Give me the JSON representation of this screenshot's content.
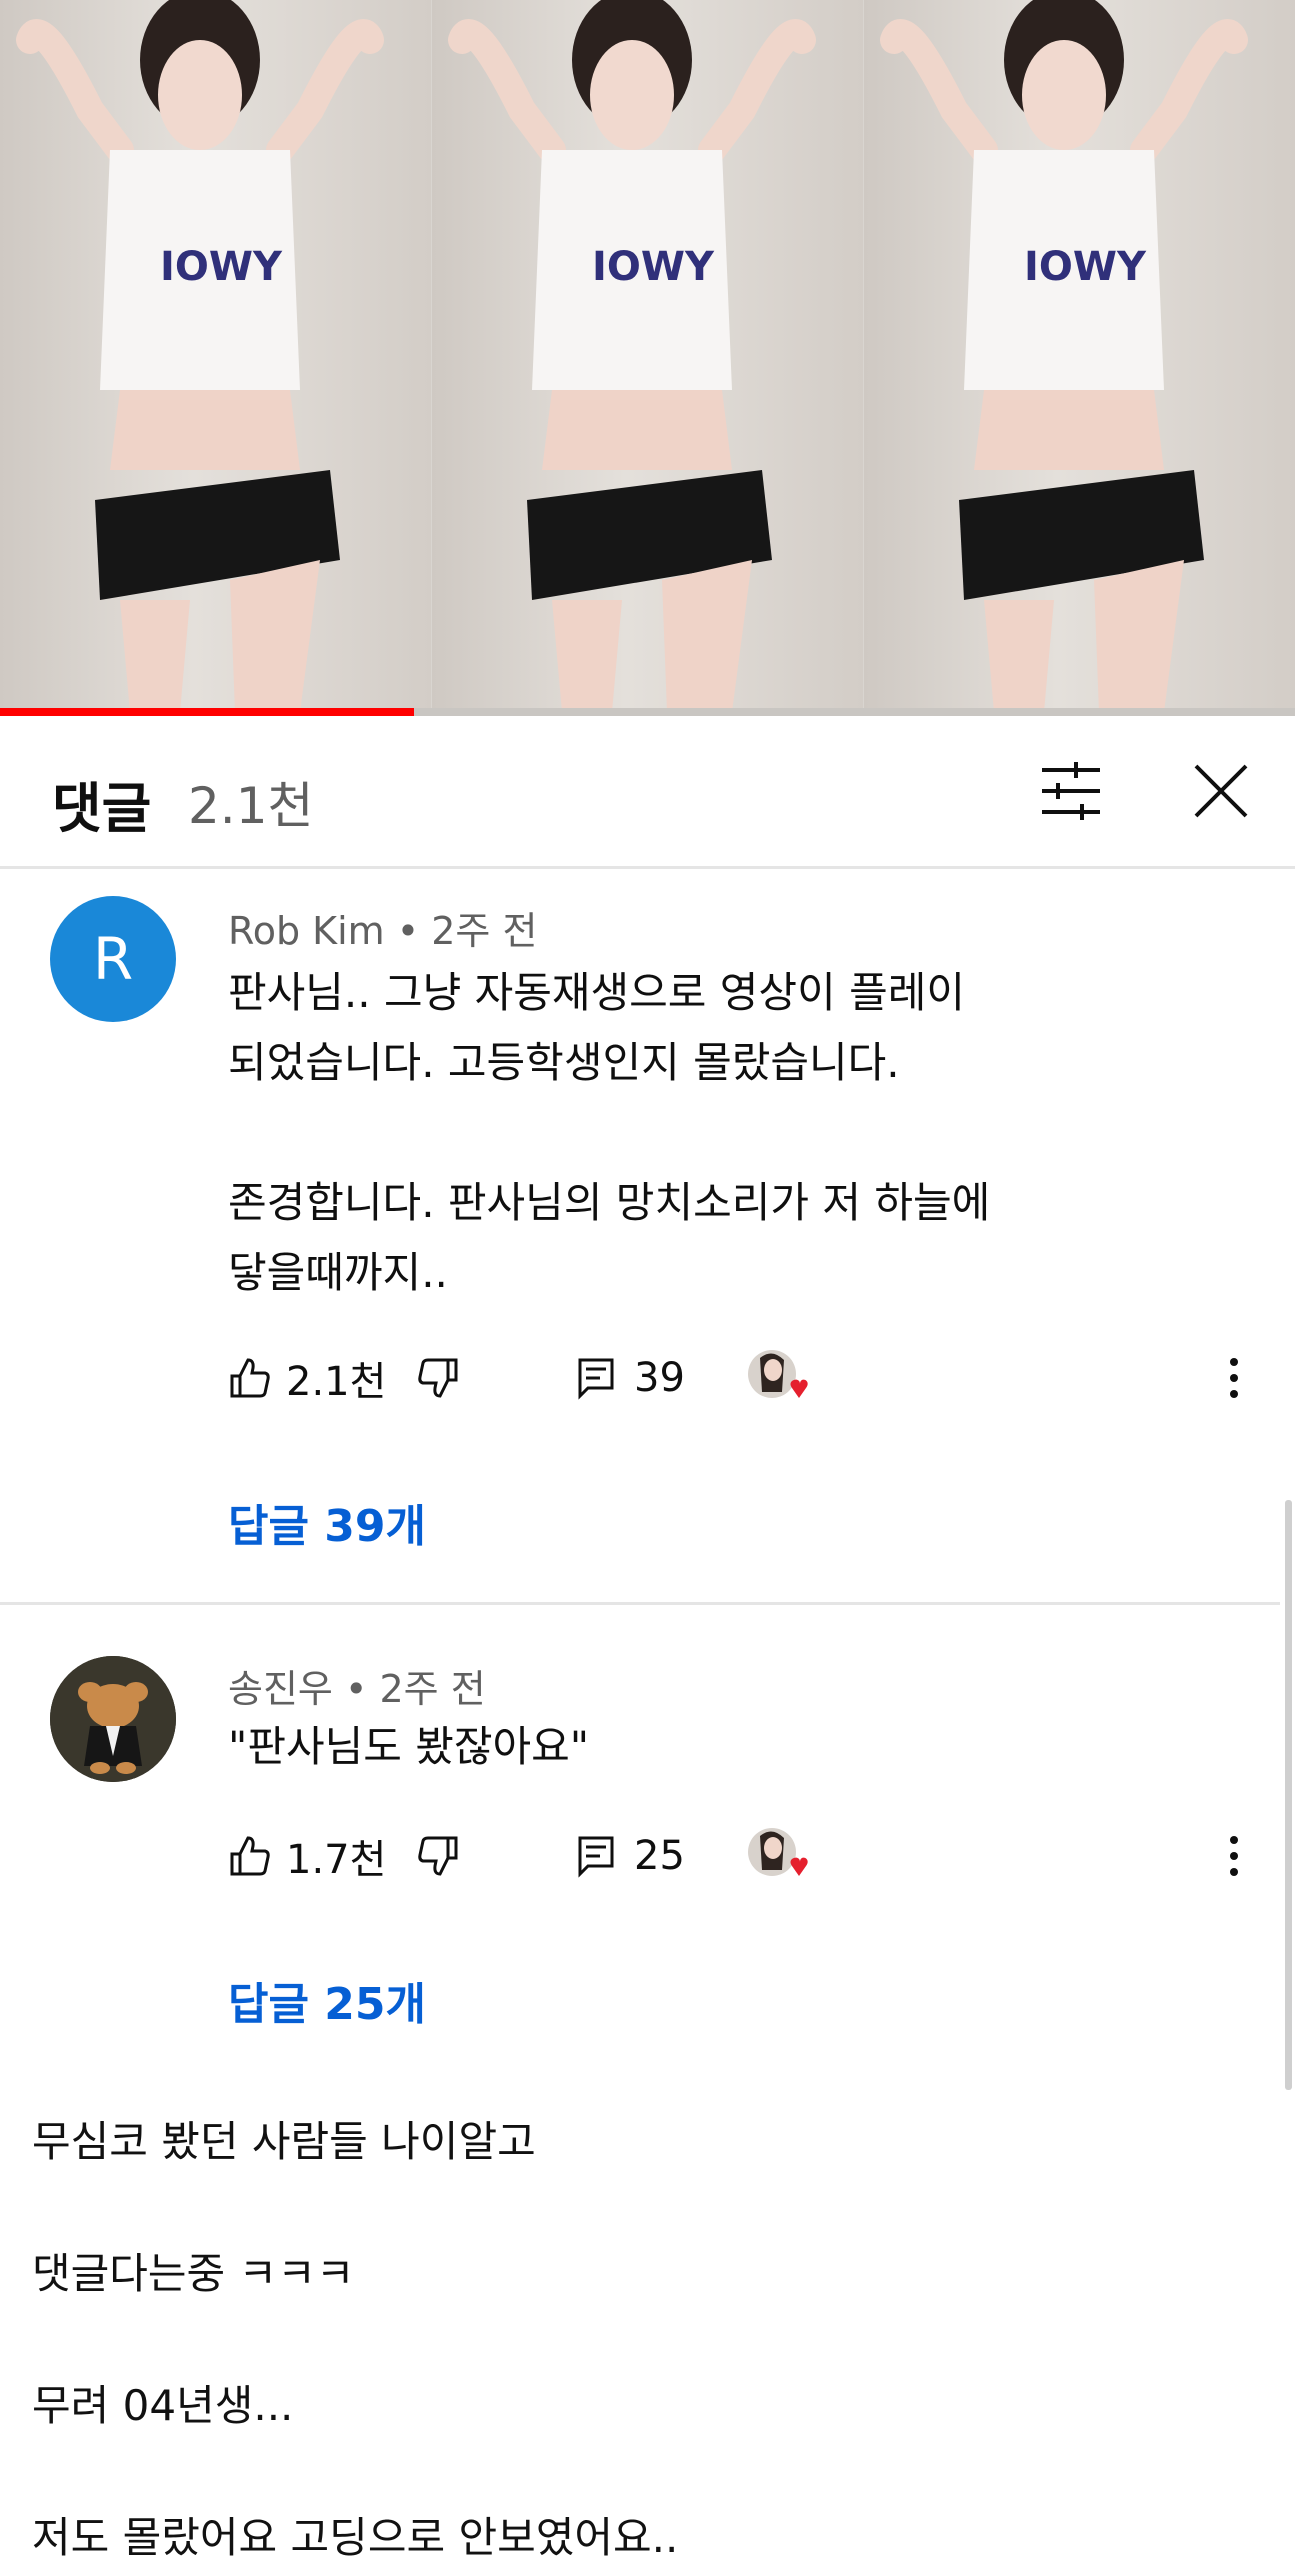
{
  "video": {
    "progress_fraction": 0.32
  },
  "header": {
    "title": "댓글",
    "count": "2.1천",
    "sort_icon": "filter-sliders-icon",
    "close_icon": "close-icon"
  },
  "comments": [
    {
      "author": "Rob Kim",
      "time": "2주 전",
      "avatar_letter": "R",
      "avatar_color": "#1a88d8",
      "text": "판사님.. 그냥 자동재생으로 영상이 플레이\n되었습니다. 고등학생인지 몰랐습니다.\n\n존경합니다. 판사님의 망치소리가 저 하늘에\n닿을때까지..",
      "likes": "2.1천",
      "reply_count": "39",
      "replies_link": "답글 39개"
    },
    {
      "author": "송진우",
      "time": "2주 전",
      "text": "\"판사님도 봤잖아요\"",
      "likes": "1.7천",
      "reply_count": "25",
      "replies_link": "답글 25개"
    }
  ],
  "caption_lines": [
    "무심코 봤던 사람들 나이알고",
    "댓글다는중 ㅋㅋㅋ",
    "무려 04년생...",
    "저도 몰랐어요 고딩으로 안보였어요.."
  ],
  "colors": {
    "accent_blue": "#065fd4",
    "progress_red": "#ff0000",
    "heart_red": "#e5202e"
  }
}
